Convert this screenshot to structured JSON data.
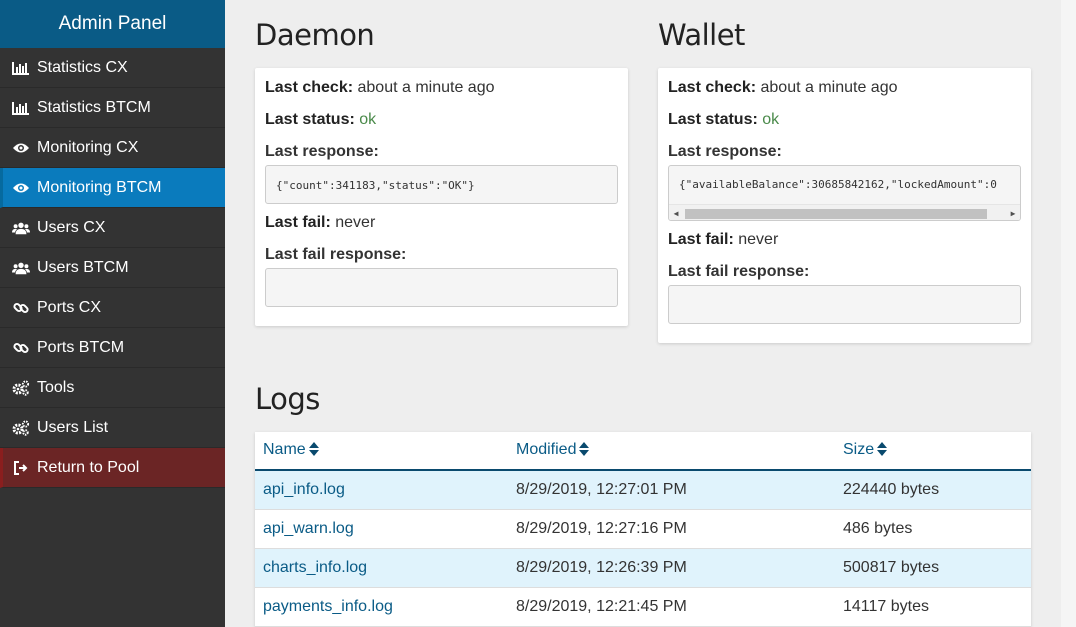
{
  "sidebar": {
    "title": "Admin Panel",
    "items": [
      {
        "label": "Statistics CX",
        "icon": "bar-chart-icon"
      },
      {
        "label": "Statistics BTCM",
        "icon": "bar-chart-icon"
      },
      {
        "label": "Monitoring CX",
        "icon": "eye-icon"
      },
      {
        "label": "Monitoring BTCM",
        "icon": "eye-icon",
        "active": true
      },
      {
        "label": "Users CX",
        "icon": "users-icon"
      },
      {
        "label": "Users BTCM",
        "icon": "users-icon"
      },
      {
        "label": "Ports CX",
        "icon": "link-icon"
      },
      {
        "label": "Ports BTCM",
        "icon": "link-icon"
      },
      {
        "label": "Tools",
        "icon": "gears-icon"
      },
      {
        "label": "Users List",
        "icon": "gears-icon"
      },
      {
        "label": "Return to Pool",
        "icon": "sign-out-icon"
      }
    ]
  },
  "daemon": {
    "title": "Daemon",
    "last_check_label": "Last check:",
    "last_check_value": "about a minute ago",
    "last_status_label": "Last status:",
    "last_status_value": "ok",
    "last_response_label": "Last response:",
    "last_response_value": "{\"count\":341183,\"status\":\"OK\"}",
    "last_fail_label": "Last fail:",
    "last_fail_value": "never",
    "last_fail_response_label": "Last fail response:"
  },
  "wallet": {
    "title": "Wallet",
    "last_check_label": "Last check:",
    "last_check_value": "about a minute ago",
    "last_status_label": "Last status:",
    "last_status_value": "ok",
    "last_response_label": "Last response:",
    "last_response_value": "{\"availableBalance\":30685842162,\"lockedAmount\":0",
    "last_fail_label": "Last fail:",
    "last_fail_value": "never",
    "last_fail_response_label": "Last fail response:"
  },
  "logs": {
    "title": "Logs",
    "columns": [
      "Name",
      "Modified",
      "Size"
    ],
    "rows": [
      {
        "name": "api_info.log",
        "modified": "8/29/2019, 12:27:01 PM",
        "size": "224440 bytes"
      },
      {
        "name": "api_warn.log",
        "modified": "8/29/2019, 12:27:16 PM",
        "size": "486 bytes"
      },
      {
        "name": "charts_info.log",
        "modified": "8/29/2019, 12:26:39 PM",
        "size": "500817 bytes"
      },
      {
        "name": "payments_info.log",
        "modified": "8/29/2019, 12:21:45 PM",
        "size": "14117 bytes"
      }
    ]
  },
  "colors": {
    "sidebar_bg": "#333333",
    "header_bg": "#0a5b86",
    "active_bg": "#0a7bbd",
    "danger_bg": "#6b2525",
    "status_ok": "#4a8a4a",
    "link": "#0a5b86",
    "row_highlight": "#e0f3fc"
  }
}
